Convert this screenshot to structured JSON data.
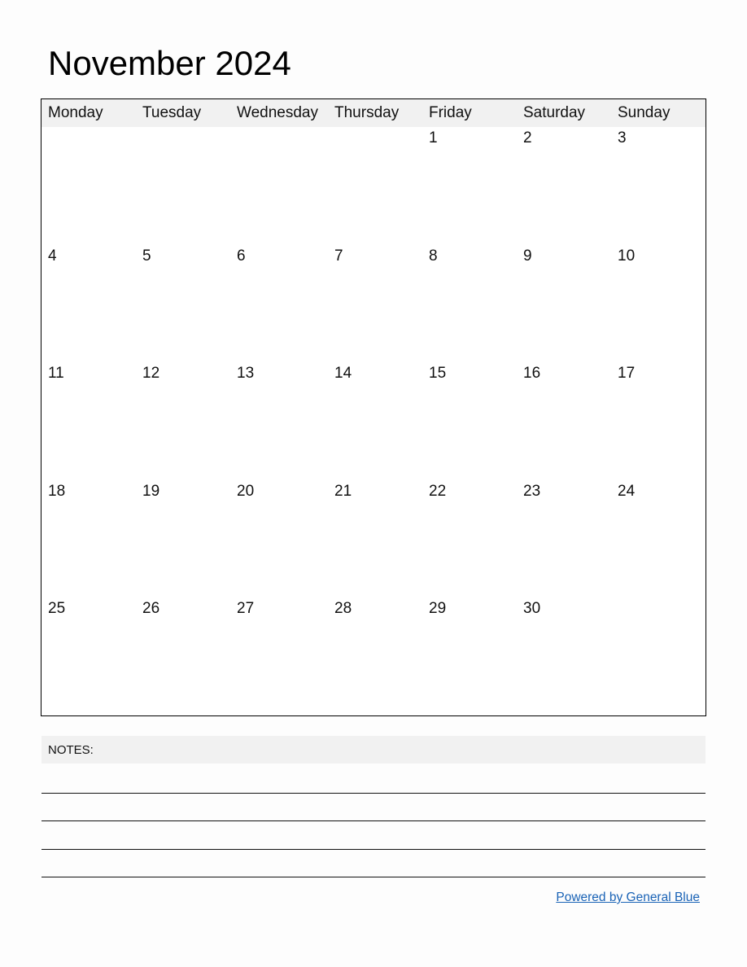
{
  "title": "November 2024",
  "weekdays": [
    "Monday",
    "Tuesday",
    "Wednesday",
    "Thursday",
    "Friday",
    "Saturday",
    "Sunday"
  ],
  "weeks": [
    [
      "",
      "",
      "",
      "",
      "1",
      "2",
      "3"
    ],
    [
      "4",
      "5",
      "6",
      "7",
      "8",
      "9",
      "10"
    ],
    [
      "11",
      "12",
      "13",
      "14",
      "15",
      "16",
      "17"
    ],
    [
      "18",
      "19",
      "20",
      "21",
      "22",
      "23",
      "24"
    ],
    [
      "25",
      "26",
      "27",
      "28",
      "29",
      "30",
      ""
    ]
  ],
  "notes": {
    "label": "NOTES:",
    "line_count": 4
  },
  "footer": {
    "link_text": "Powered by General Blue",
    "link_color": "#1a63b6"
  }
}
